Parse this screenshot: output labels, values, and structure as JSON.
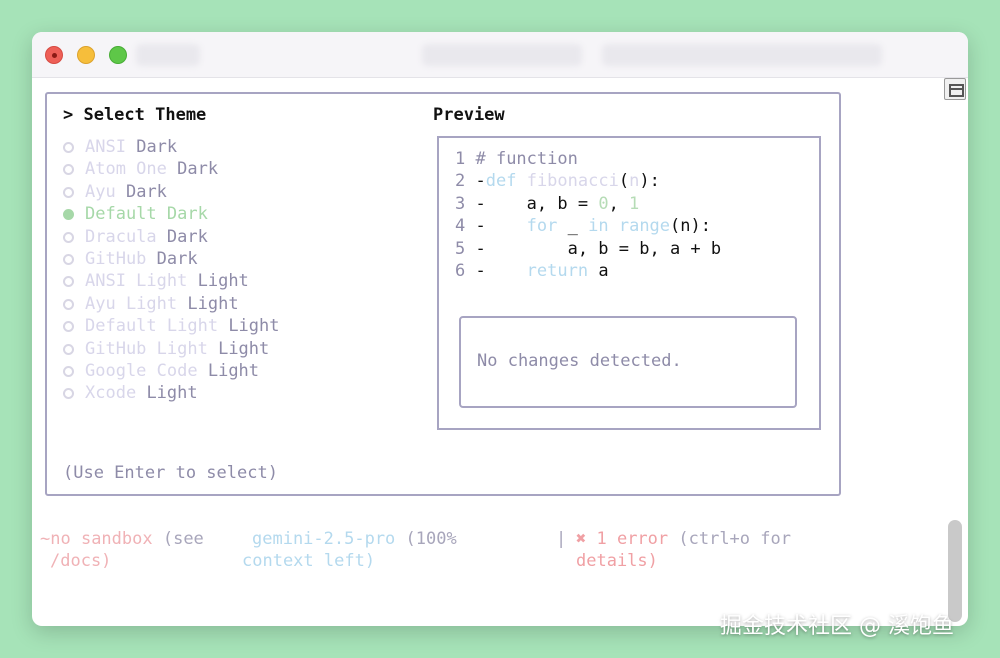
{
  "window": {
    "controls": [
      "close",
      "minimize",
      "zoom"
    ]
  },
  "theme_selector": {
    "heading": "> Select Theme",
    "themes": [
      {
        "name": "ANSI",
        "kind": "Dark",
        "selected": false
      },
      {
        "name": "Atom One",
        "kind": "Dark",
        "selected": false
      },
      {
        "name": "Ayu",
        "kind": "Dark",
        "selected": false
      },
      {
        "name": "Default",
        "kind": "Dark",
        "selected": true
      },
      {
        "name": "Dracula",
        "kind": "Dark",
        "selected": false
      },
      {
        "name": "GitHub",
        "kind": "Dark",
        "selected": false
      },
      {
        "name": "ANSI Light",
        "kind": "Light",
        "selected": false
      },
      {
        "name": "Ayu Light",
        "kind": "Light",
        "selected": false
      },
      {
        "name": "Default Light",
        "kind": "Light",
        "selected": false
      },
      {
        "name": "GitHub Light",
        "kind": "Light",
        "selected": false
      },
      {
        "name": "Google Code",
        "kind": "Light",
        "selected": false
      },
      {
        "name": "Xcode",
        "kind": "Light",
        "selected": false
      }
    ],
    "hint": "(Use Enter to select)"
  },
  "preview": {
    "heading": "Preview",
    "code_lines": [
      {
        "num": "1",
        "tokens": [
          {
            "t": " # function",
            "c": "comment"
          }
        ]
      },
      {
        "num": "2",
        "tokens": [
          {
            "t": " -",
            "c": "plain"
          },
          {
            "t": "def",
            "c": "kw"
          },
          {
            "t": " ",
            "c": "plain"
          },
          {
            "t": "fibonacci",
            "c": "fn"
          },
          {
            "t": "(",
            "c": "plain"
          },
          {
            "t": "n",
            "c": "fn"
          },
          {
            "t": "):",
            "c": "plain"
          }
        ]
      },
      {
        "num": "3",
        "tokens": [
          {
            "t": " -    a, b = ",
            "c": "plain"
          },
          {
            "t": "0",
            "c": "num"
          },
          {
            "t": ", ",
            "c": "plain"
          },
          {
            "t": "1",
            "c": "num"
          }
        ]
      },
      {
        "num": "4",
        "tokens": [
          {
            "t": " -    ",
            "c": "plain"
          },
          {
            "t": "for",
            "c": "kw"
          },
          {
            "t": " _ ",
            "c": "plain"
          },
          {
            "t": "in",
            "c": "kw"
          },
          {
            "t": " ",
            "c": "plain"
          },
          {
            "t": "range",
            "c": "kw"
          },
          {
            "t": "(n):",
            "c": "plain"
          }
        ]
      },
      {
        "num": "5",
        "tokens": [
          {
            "t": " -        a, b = b, a + b",
            "c": "plain"
          }
        ]
      },
      {
        "num": "6",
        "tokens": [
          {
            "t": " -    ",
            "c": "plain"
          },
          {
            "t": "return",
            "c": "kw"
          },
          {
            "t": " a",
            "c": "plain"
          }
        ]
      }
    ],
    "diff_message": "No changes detected."
  },
  "footer": {
    "sandbox_prefix": "~",
    "sandbox_label": "no sandbox",
    "sandbox_see": " (see",
    "sandbox_docs": "/docs)",
    "model": "gemini-2.5-pro",
    "context_pct": " (100%",
    "context_left": "context left)",
    "separator": "|",
    "error_icon": "✖",
    "error_text": " 1 error",
    "error_hint": " (ctrl+o for",
    "error_details": "details)"
  },
  "watermark": "掘金技术社区 @ 溪饱鱼",
  "colors": {
    "background": "#a6e3b8",
    "selected_theme": "#a6d8a8",
    "border": "#a7a4c2",
    "error": "#f0a0a4",
    "model": "#b4d9ee"
  }
}
